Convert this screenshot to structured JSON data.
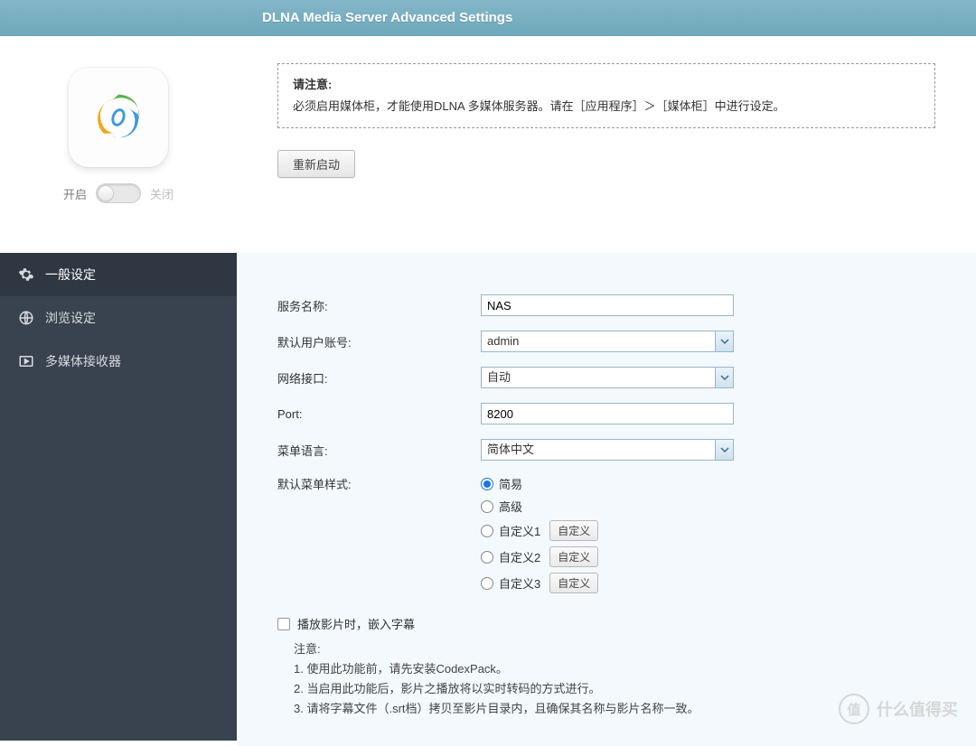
{
  "banner": {
    "title": "DLNA Media Server Advanced Settings"
  },
  "toggle": {
    "on": "开启",
    "off": "关闭"
  },
  "sidebar": {
    "items": [
      {
        "label": "一般设定"
      },
      {
        "label": "浏览设定"
      },
      {
        "label": "多媒体接收器"
      }
    ]
  },
  "notice": {
    "heading": "请注意:",
    "body": "必须启用媒体柜，才能使用DLNA 多媒体服务器。请在［应用程序］＞［媒体柜］中进行设定。"
  },
  "restart": {
    "label": "重新启动"
  },
  "form": {
    "service_name": {
      "label": "服务名称:",
      "value": "NAS"
    },
    "default_user": {
      "label": "默认用户账号:",
      "value": "admin"
    },
    "interface": {
      "label": "网络接口:",
      "value": "自动"
    },
    "port": {
      "label": "Port:",
      "value": "8200"
    },
    "menu_lang": {
      "label": "菜单语言:",
      "value": "简体中文"
    },
    "menu_style": {
      "label": "默认菜单样式:",
      "options": [
        {
          "label": "简易",
          "checked": true
        },
        {
          "label": "高级",
          "checked": false
        },
        {
          "label": "自定义1",
          "checked": false,
          "btn": "自定义"
        },
        {
          "label": "自定义2",
          "checked": false,
          "btn": "自定义"
        },
        {
          "label": "自定义3",
          "checked": false,
          "btn": "自定义"
        }
      ]
    },
    "embed_sub": {
      "label": "播放影片时，嵌入字幕"
    },
    "notes": {
      "heading": "注意:",
      "n1": "1. 使用此功能前，请先安装CodexPack。",
      "n2": "2. 当启用此功能后，影片之播放将以实时转码的方式进行。",
      "n3": "3. 请将字幕文件（.srt档）拷贝至影片目录内，且确保其名称与影片名称一致。"
    }
  },
  "watermark": {
    "char": "值",
    "text": "什么值得买"
  }
}
